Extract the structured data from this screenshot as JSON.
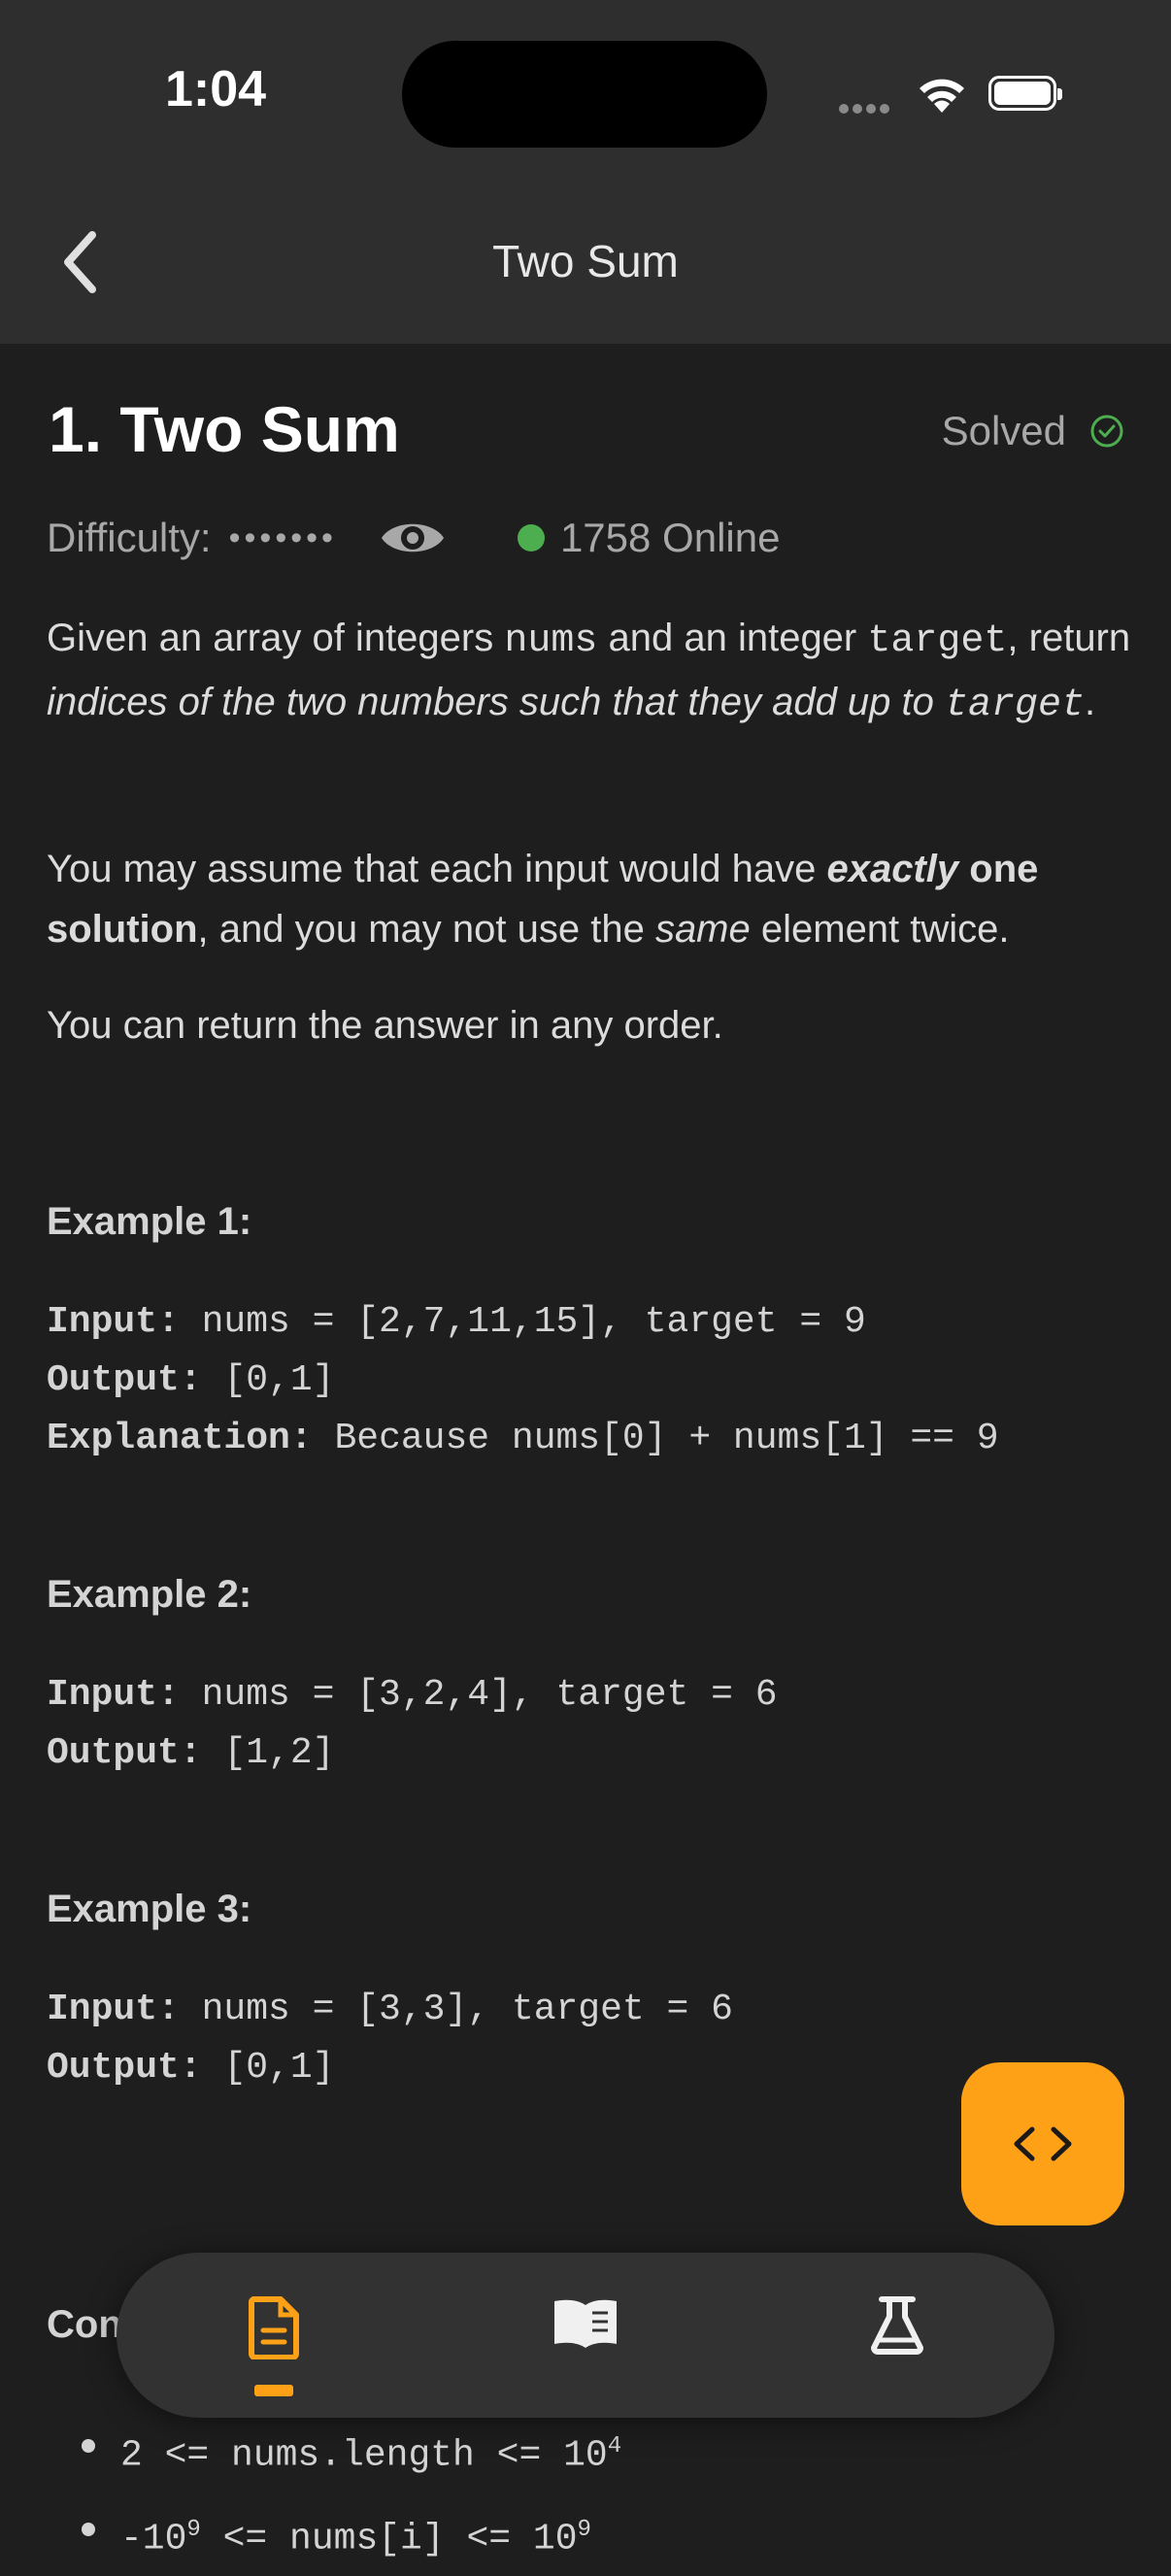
{
  "status": {
    "time": "1:04"
  },
  "nav": {
    "title": "Two Sum"
  },
  "problem": {
    "title": "1. Two Sum",
    "solved_label": "Solved",
    "difficulty_label": "Difficulty:",
    "difficulty_mask": "•••••••",
    "online_text": "1758 Online"
  },
  "description": {
    "p1_a": "Given an array of integers ",
    "p1_nums": "nums",
    "p1_b": " and an integer ",
    "p1_target": "target",
    "p1_c": ", return ",
    "p1_em": "indices of the two numbers such that they add up to",
    "p1_target2": "target",
    "p1_end": ".",
    "p2_a": "You may assume that each input would have ",
    "p2_em": "exactly",
    "p2_b": " one solution",
    "p2_c": ", and you may not use the ",
    "p2_em2": "same",
    "p2_d": " element twice.",
    "p3": "You can return the answer in any order."
  },
  "examples": [
    {
      "heading": "Example 1:",
      "input_label": "Input:",
      "input": " nums = [2,7,11,15], target = 9",
      "output_label": "Output:",
      "output": " [0,1]",
      "explanation_label": "Explanation:",
      "explanation": " Because nums[0] + nums[1] == 9"
    },
    {
      "heading": "Example 2:",
      "input_label": "Input:",
      "input": " nums = [3,2,4], target = 6",
      "output_label": "Output:",
      "output": " [1,2]"
    },
    {
      "heading": "Example 3:",
      "input_label": "Input:",
      "input": " nums = [3,3], target = 6",
      "output_label": "Output:",
      "output": " [0,1]"
    }
  ],
  "constraints": {
    "heading": "Con",
    "c1_a": "2 <= nums.length <= 10",
    "c1_exp": "4",
    "c2_a": "-10",
    "c2_exp1": "9",
    "c2_b": " <= nums[i] <= 10",
    "c2_exp2": "9"
  },
  "icons": {
    "fab": "code-brackets-icon",
    "tabs": [
      "description-icon",
      "editorial-book-icon",
      "test-flask-icon"
    ]
  },
  "colors": {
    "accent": "#ffa116",
    "online": "#4cae4f",
    "solved": "#4cae4f"
  }
}
